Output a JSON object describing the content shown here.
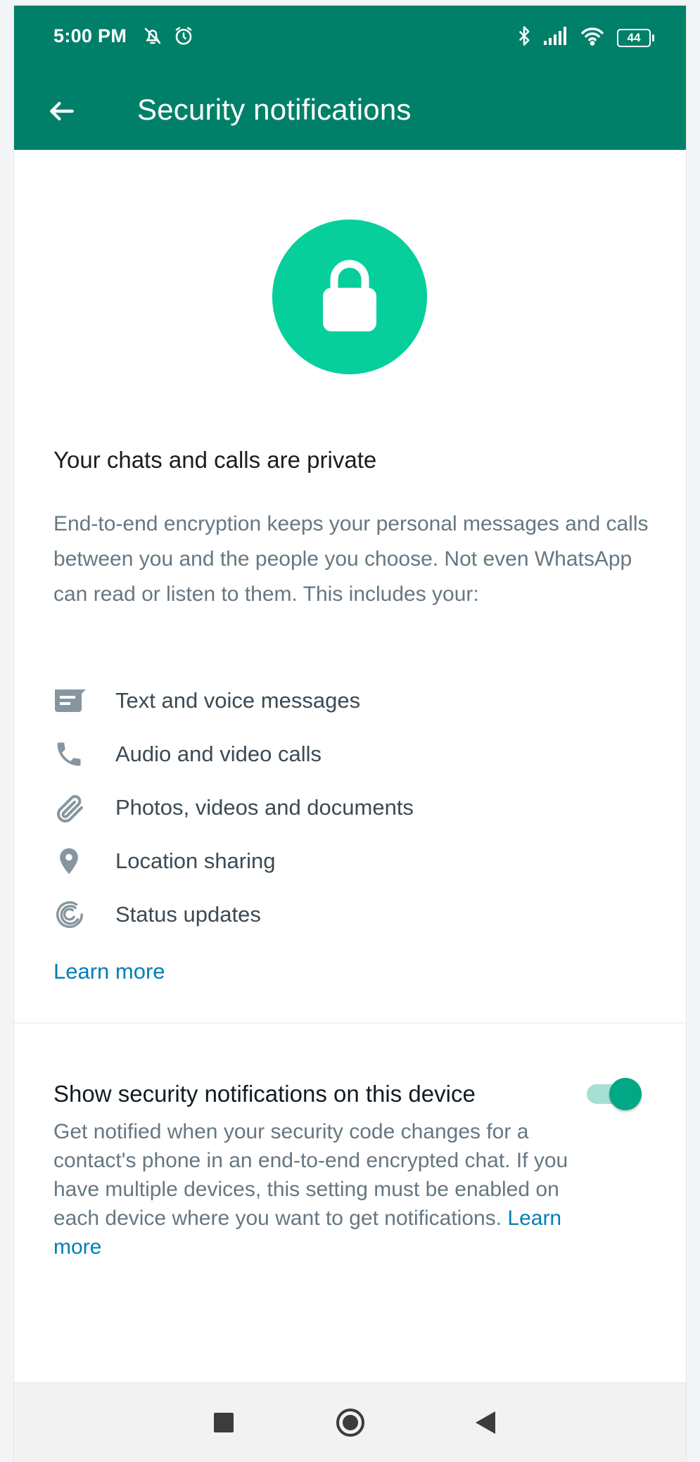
{
  "status_bar": {
    "time": "5:00 PM",
    "battery": "44",
    "icons": [
      "mute-bell-icon",
      "alarm-icon",
      "bluetooth-icon",
      "signal-icon",
      "wifi-icon",
      "battery-icon"
    ]
  },
  "toolbar": {
    "title": "Security notifications",
    "back_icon": "arrow-left-icon"
  },
  "colors": {
    "header": "#008069",
    "lock_circle": "#06cf9c",
    "link": "#027eb5",
    "toggle_on": "#00a884"
  },
  "intro": {
    "heading": "Your chats and calls are private",
    "description": "End-to-end encryption keeps your personal messages and calls between you and the people you choose. Not even WhatsApp can read or listen to them. This includes your:",
    "features": [
      {
        "icon": "message-icon",
        "label": "Text and voice messages"
      },
      {
        "icon": "phone-icon",
        "label": "Audio and video calls"
      },
      {
        "icon": "paperclip-icon",
        "label": "Photos, videos and documents"
      },
      {
        "icon": "location-pin-icon",
        "label": "Location sharing"
      },
      {
        "icon": "status-icon",
        "label": "Status updates"
      }
    ],
    "learn_more": "Learn more"
  },
  "setting": {
    "title": "Show security notifications on this device",
    "description": "Get notified when your security code changes for a contact's phone in an end-to-end encrypted chat. If you have multiple devices, this setting must be enabled on each device where you want to get notifications.",
    "learn_more": "Learn more",
    "enabled": true
  },
  "nav": {
    "icons": [
      "recents-square-icon",
      "home-circle-icon",
      "back-triangle-icon"
    ]
  }
}
